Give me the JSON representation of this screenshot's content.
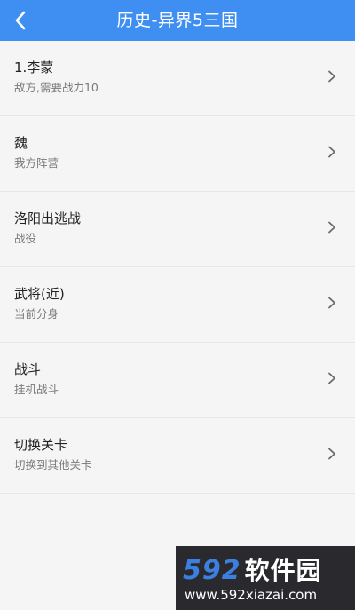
{
  "header": {
    "title": "历史-异界5三国",
    "back_icon": "chevron-left-icon",
    "background_color": "#3e8ff1"
  },
  "items": [
    {
      "title": "1.李蒙",
      "subtitle": "敌方,需要战力10"
    },
    {
      "title": "魏",
      "subtitle": "我方阵营"
    },
    {
      "title": "洛阳出逃战",
      "subtitle": "战役"
    },
    {
      "title": "武将(近)",
      "subtitle": "当前分身"
    },
    {
      "title": "战斗",
      "subtitle": "挂机战斗"
    },
    {
      "title": "切换关卡",
      "subtitle": "切换到其他关卡"
    }
  ],
  "chevron_icon": "chevron-right-icon",
  "watermark": {
    "logo_number": "592",
    "logo_text": "软件园",
    "url": "www.592xiazai.com"
  }
}
